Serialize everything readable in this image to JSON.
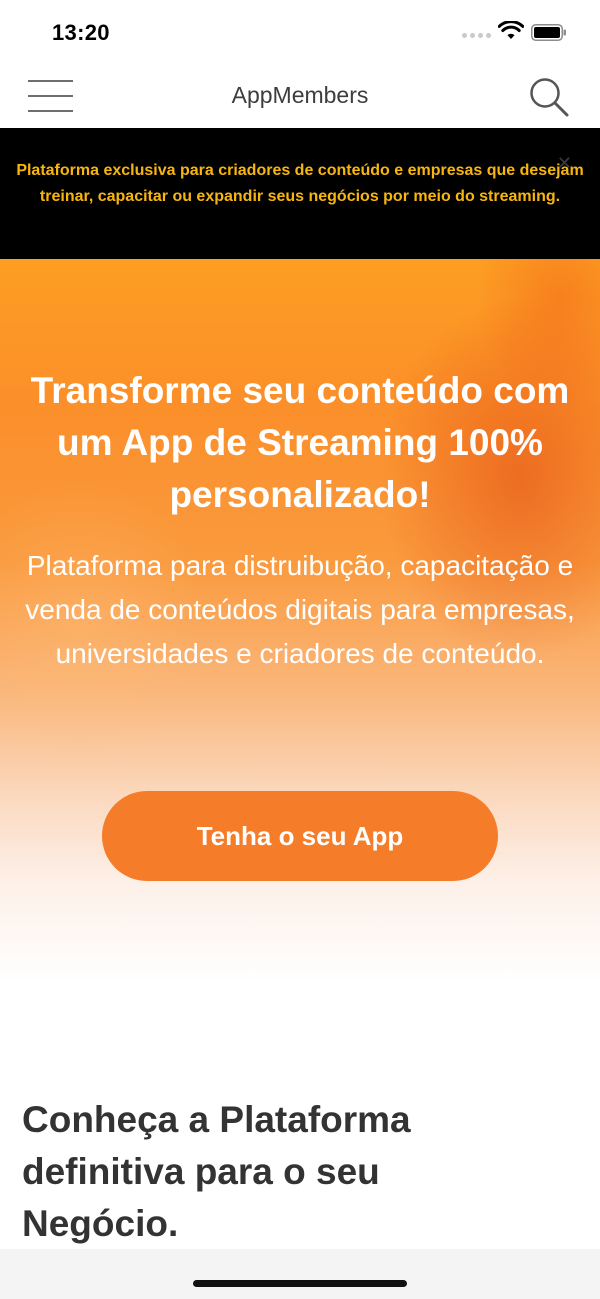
{
  "status_bar": {
    "time": "13:20",
    "icons": [
      "signal-dots-icon",
      "wifi-icon",
      "battery-icon"
    ]
  },
  "nav": {
    "title": "AppMembers",
    "icons": [
      "hamburger-menu-icon",
      "search-icon"
    ]
  },
  "banner": {
    "text": "Plataforma exclusiva para criadores de conteúdo e empresas que desejam treinar, capacitar ou expandir seus negócios por meio do streaming.",
    "text_color": "#f7b60f",
    "background": "#000000"
  },
  "hero": {
    "title": "Transforme seu conteúdo com um App de Streaming 100% personalizado!",
    "subtitle": "Plataforma para distruibução, capacitação e venda de conteúdos digitais para empresas, universidades e criadores de conteúdo.",
    "cta_label": "Tenha o seu App",
    "accent_color": "#f57c28"
  },
  "section": {
    "title": "Conheça a Plataforma definitiva para o seu Negócio."
  }
}
